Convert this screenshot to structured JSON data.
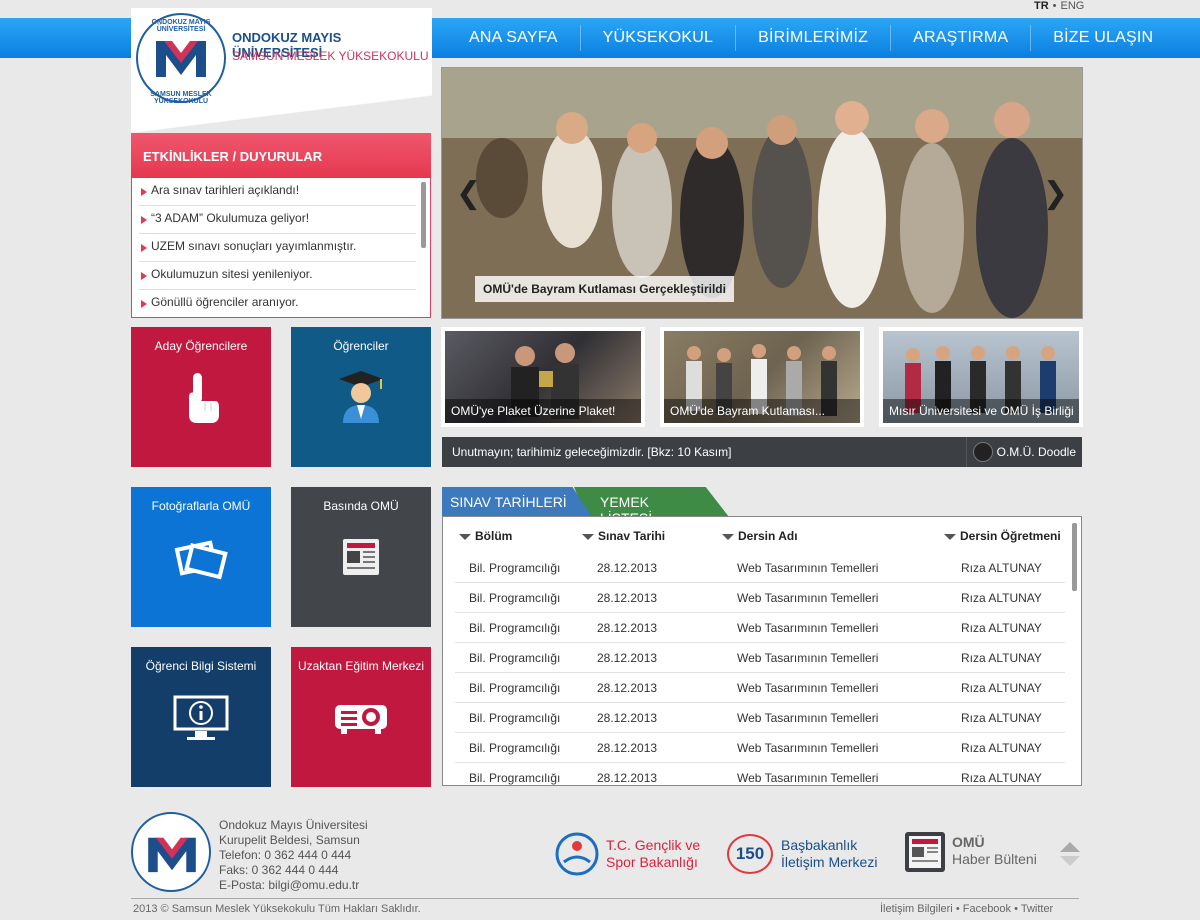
{
  "lang": {
    "tr": "TR",
    "sep": "•",
    "eng": "ENG"
  },
  "nav": [
    "ANA SAYFA",
    "YÜKSEKOKUL",
    "BİRİMLERİMİZ",
    "ARAŞTIRMA",
    "BİZE ULAŞIN"
  ],
  "logo": {
    "line1": "ONDOKUZ MAYIS ÜNİVERSİTESİ",
    "line2": "SAMSUN MESLEK YÜKSEKOKULU",
    "seal_top": "ONDOKUZ MAYIS ÜNİVERSİTESİ",
    "seal_bottom": "SAMSUN MESLEK YÜKSEKOKULU"
  },
  "announcements": {
    "title": "ETKİNLİKLER / DUYURULAR",
    "items": [
      "Ara sınav tarihleri açıklandı!",
      "“3 ADAM” Okulumuza geliyor!",
      "UZEM sınavı sonuçları yayımlanmıştır.",
      "Okulumuzun sitesi yenileniyor.",
      "Gönüllü öğrenciler aranıyor."
    ]
  },
  "tiles": [
    {
      "label": "Aday Öğrencilere",
      "icon": "hand-pointer-icon",
      "color": "#c0183f"
    },
    {
      "label": "Öğrenciler",
      "icon": "graduate-icon",
      "color": "#0f5a86"
    },
    {
      "label": "Fotoğraflarla OMÜ",
      "icon": "photos-icon",
      "color": "#0b74d4"
    },
    {
      "label": "Basında OMÜ",
      "icon": "newspaper-icon",
      "color": "#424549"
    },
    {
      "label": "Öğrenci Bilgi Sistemi",
      "icon": "info-monitor-icon",
      "color": "#143e6a"
    },
    {
      "label": "Uzaktan Eğitim Merkezi",
      "icon": "projector-icon",
      "color": "#c0183f"
    }
  ],
  "slider": {
    "caption": "OMÜ'de Bayram Kutlaması Gerçekleştirildi",
    "prev": "❮",
    "next": "❯"
  },
  "thumbs": [
    "OMÜ'ye Plaket Üzerine Plaket!",
    "OMÜ'de Bayram Kutlaması...",
    "Mısır Üniversitesi ve OMÜ İş Birliği"
  ],
  "doodle": {
    "text": "Unutmayın; tarihimiz geleceğimizdir. [Bkz: 10 Kasım]",
    "brand": "O.M.Ü. Doodle"
  },
  "exam_tabs": {
    "active": "SINAV TARİHLERİ",
    "other": "YEMEK LİSTESİ"
  },
  "exam_table": {
    "headers": [
      "Bölüm",
      "Sınav Tarihi",
      "Dersin Adı",
      "Dersin Öğretmeni"
    ],
    "rows": [
      [
        "Bil. Programcılığı",
        "28.12.2013",
        "Web Tasarımının Temelleri",
        "Rıza ALTUNAY"
      ],
      [
        "Bil. Programcılığı",
        "28.12.2013",
        "Web Tasarımının Temelleri",
        "Rıza ALTUNAY"
      ],
      [
        "Bil. Programcılığı",
        "28.12.2013",
        "Web Tasarımının Temelleri",
        "Rıza ALTUNAY"
      ],
      [
        "Bil. Programcılığı",
        "28.12.2013",
        "Web Tasarımının Temelleri",
        "Rıza ALTUNAY"
      ],
      [
        "Bil. Programcılığı",
        "28.12.2013",
        "Web Tasarımının Temelleri",
        "Rıza ALTUNAY"
      ],
      [
        "Bil. Programcılığı",
        "28.12.2013",
        "Web Tasarımının Temelleri",
        "Rıza ALTUNAY"
      ],
      [
        "Bil. Programcılığı",
        "28.12.2013",
        "Web Tasarımının Temelleri",
        "Rıza ALTUNAY"
      ],
      [
        "Bil. Programcılığı",
        "28.12.2013",
        "Web Tasarımının Temelleri",
        "Rıza ALTUNAY"
      ]
    ]
  },
  "footer": {
    "address": [
      "Ondokuz Mayıs Üniversitesi",
      "Kurupelit Beldesi, Samsun",
      "Telefon: 0 362 444 0 444",
      "Faks: 0 362 444 0 444",
      "E-Posta: bilgi@omu.edu.tr"
    ],
    "partner1": [
      "T.C. Gençlik ve",
      "Spor Bakanlığı"
    ],
    "partner2": [
      "Başbakanlık",
      "İletişim Merkezi"
    ],
    "partner2_badge": "150",
    "partner3": [
      "OMÜ",
      "Haber Bülteni"
    ],
    "copyright": "2013 © Samsun Meslek Yüksekokulu Tüm Hakları Saklıdır.",
    "links": [
      "İletişim Bilgileri",
      "Facebook",
      "Twitter"
    ],
    "link_sep": "•"
  }
}
